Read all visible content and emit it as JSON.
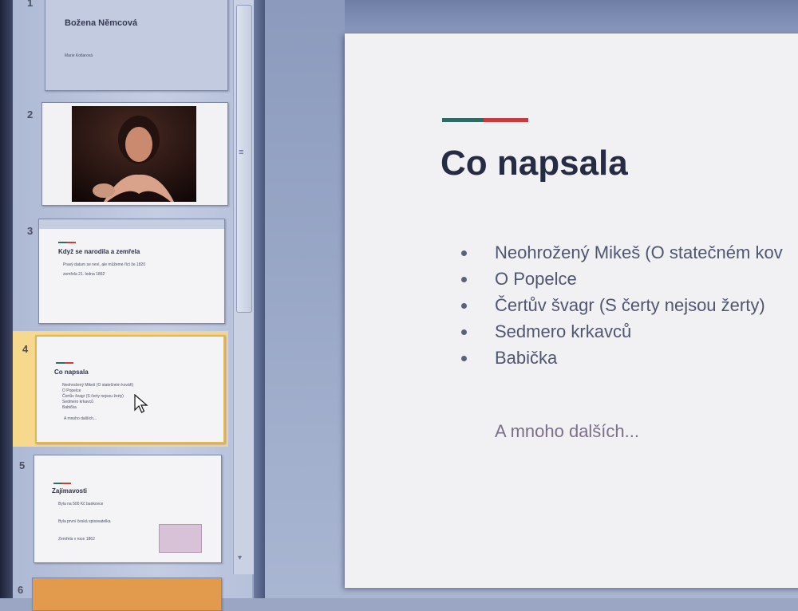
{
  "thumbnails": [
    {
      "number": "1",
      "title": "Božena Němcová",
      "sub": "Marie Kotlarová"
    },
    {
      "number": "2"
    },
    {
      "number": "3",
      "title": "Když se narodila a zemřela",
      "lines": [
        "Pravý datum se neví, ale můžeme říct že 1820",
        "zemřela 21. ledna 1862"
      ]
    },
    {
      "number": "4",
      "title": "Co napsala",
      "lines": [
        "Neohrožený Mikeš (O statečném kováři)",
        "O Popelce",
        "Čertův švagr (S čerty nejsou žerty)",
        "Sedmero krkavců",
        "Babička"
      ],
      "more": "A mnoho dalších..."
    },
    {
      "number": "5",
      "title": "Zajímavosti",
      "lines": [
        "Byla na 500 Kč bankovce",
        "Byla první česká spisovatelka",
        "Zemřela v roce 1862"
      ]
    },
    {
      "number": "6"
    }
  ],
  "slide": {
    "title": "Co napsala",
    "bullets": [
      "Neohrožený Mikeš (O statečném kov",
      "O Popelce",
      "Čertův švagr (S čerty nejsou žerty)",
      "Sedmero krkavců",
      "Babička"
    ],
    "more": "A mnoho dalších...",
    "accent_green": "#2f6b63",
    "accent_red": "#c73a3e"
  },
  "icons": {
    "cursor": "mouse-pointer-icon",
    "scroll_grip": "grip-icon",
    "scroll_down": "chevron-down-icon"
  }
}
